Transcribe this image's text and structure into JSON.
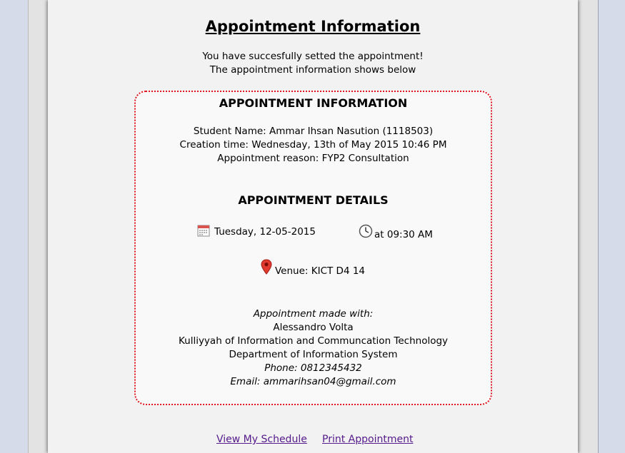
{
  "page": {
    "title": "Appointment Information",
    "intro_line1": "You have succesfully setted the appointment!",
    "intro_line2": "The appointment information shows below"
  },
  "info": {
    "heading": "APPOINTMENT INFORMATION",
    "student_name": "Student Name: Ammar Ihsan Nasution (1118503)",
    "creation_time": "Creation time: Wednesday, 13th of May 2015 10:46 PM",
    "reason": "Appointment reason: FYP2 Consultation"
  },
  "details": {
    "heading": "APPOINTMENT DETAILS",
    "date": "Tuesday, 12-05-2015",
    "date_icon": "calendar-icon",
    "time": "at 09:30 AM",
    "time_icon": "clock-icon",
    "venue": "Venue: KICT D4 14",
    "venue_icon": "map-pin-icon"
  },
  "made_with": {
    "label": "Appointment made with:",
    "name": "Alessandro Volta",
    "faculty": "Kulliyyah of Information and Communcation Technology",
    "department": "Department of Information System",
    "phone": "Phone: 0812345432",
    "email": "Email: ammarihsan04@gmail.com"
  },
  "links": {
    "schedule": "View My Schedule",
    "print": "Print Appointment"
  },
  "colors": {
    "card_border": "#e0141e",
    "link": "#551a8b",
    "page_bg": "#f2f2f2",
    "outer_bg": "#d6dbe9"
  }
}
